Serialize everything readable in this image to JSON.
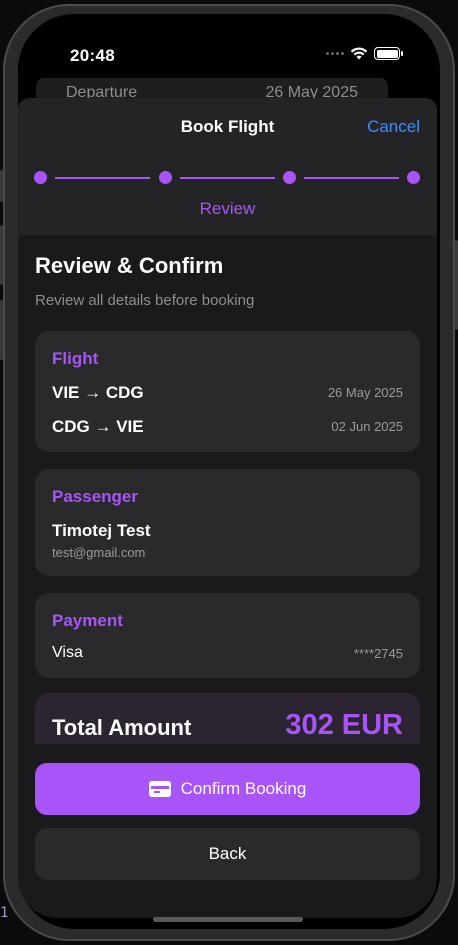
{
  "status": {
    "time": "20:48"
  },
  "behind": {
    "label": "Departure",
    "date": "26 May 2025"
  },
  "header": {
    "title": "Book Flight",
    "cancel": "Cancel",
    "step_label": "Review"
  },
  "review": {
    "title": "Review & Confirm",
    "subtitle": "Review all details before booking",
    "flight": {
      "heading": "Flight",
      "legs": [
        {
          "route": "VIE → CDG",
          "date": "26 May 2025"
        },
        {
          "route": "CDG → VIE",
          "date": "02 Jun 2025"
        }
      ]
    },
    "passenger": {
      "heading": "Passenger",
      "name": "Timotej Test",
      "email": "test@gmail.com"
    },
    "payment": {
      "heading": "Payment",
      "method": "Visa",
      "card_masked": "****2745"
    },
    "total": {
      "label": "Total Amount",
      "value": "302 EUR"
    }
  },
  "actions": {
    "confirm": "Confirm Booking",
    "back": "Back"
  },
  "edge_text": "1",
  "colors": {
    "accent": "#a855f7",
    "link": "#3b8dff",
    "background": "#1a1a1c",
    "card": "#2a2a2d"
  },
  "icons": [
    "wifi-icon",
    "battery-icon",
    "credit-card-icon"
  ]
}
